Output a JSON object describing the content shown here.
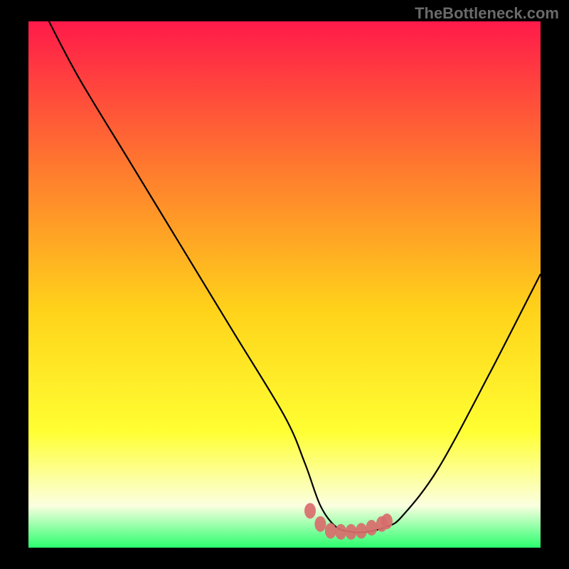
{
  "watermark": "TheBottleneck.com",
  "colors": {
    "background": "#000000",
    "gradient_top": "#ff1a4a",
    "gradient_mid1": "#ff7a2e",
    "gradient_mid2": "#ffd31a",
    "gradient_mid3": "#ffff33",
    "gradient_mid4": "#fbffe0",
    "gradient_bot": "#2aff6e",
    "curve": "#000000",
    "marker": "#d96c6c"
  },
  "chart_data": {
    "type": "line",
    "title": "",
    "xlabel": "",
    "ylabel": "",
    "xlim": [
      0,
      100
    ],
    "ylim": [
      0,
      100
    ],
    "grid": false,
    "legend": false,
    "series": [
      {
        "name": "bottleneck-curve",
        "x": [
          4,
          10,
          20,
          30,
          40,
          50,
          54,
          57,
          60,
          63,
          66,
          70,
          73,
          80,
          90,
          100
        ],
        "y": [
          100,
          89,
          73,
          57,
          41,
          25,
          16,
          8,
          4,
          3,
          3,
          4,
          6,
          15,
          33,
          52
        ]
      }
    ],
    "markers": {
      "name": "bottom-highlight",
      "x": [
        55,
        57,
        59,
        61,
        63,
        65,
        67,
        69,
        70
      ],
      "y": [
        7,
        4.5,
        3.2,
        3,
        3,
        3.2,
        3.8,
        4.5,
        5
      ]
    }
  }
}
